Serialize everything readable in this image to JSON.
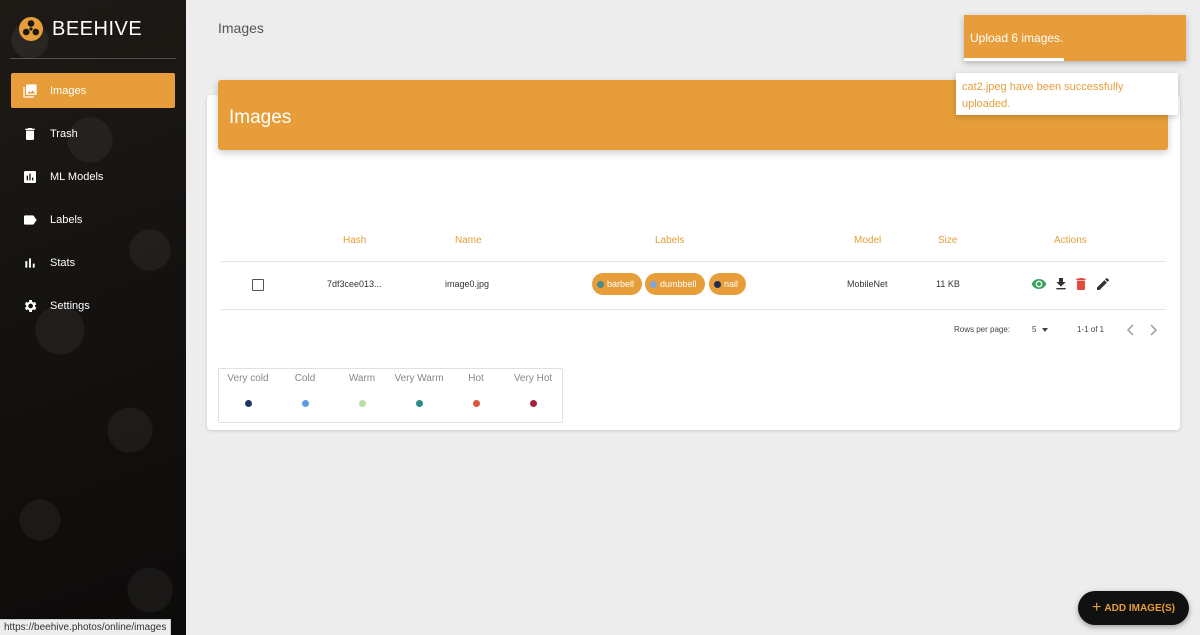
{
  "brand": {
    "name": "BEEHIVE",
    "icon": "beehive-logo-icon"
  },
  "sidebar": {
    "items": [
      {
        "label": "Images",
        "icon": "image-icon",
        "active": true
      },
      {
        "label": "Trash",
        "icon": "trash-icon"
      },
      {
        "label": "ML Models",
        "icon": "chart-icon"
      },
      {
        "label": "Labels",
        "icon": "label-icon"
      },
      {
        "label": "Stats",
        "icon": "bar-chart-icon"
      },
      {
        "label": "Settings",
        "icon": "gear-icon"
      }
    ]
  },
  "status_url": "https://beehive.photos/online/images",
  "page": {
    "title": "Images"
  },
  "card": {
    "title": "Images"
  },
  "table": {
    "headers": {
      "hash": "Hash",
      "name": "Name",
      "labels": "Labels",
      "model": "Model",
      "size": "Size",
      "actions": "Actions"
    },
    "rows": [
      {
        "hash": "7df3cee013...",
        "name": "image0.jpg",
        "labels": [
          {
            "text": "barbell",
            "color": "#4a8a8a"
          },
          {
            "text": "dumbbell",
            "color": "#7fa6d8"
          },
          {
            "text": "nail",
            "color": "#1f2d4f"
          }
        ],
        "model": "MobileNet",
        "size": "11 KB"
      }
    ]
  },
  "pagination": {
    "rows_label": "Rows per page:",
    "rows_value": "5",
    "range": "1-1 of 1"
  },
  "legend": [
    {
      "label": "Very cold",
      "color": "#1f3566"
    },
    {
      "label": "Cold",
      "color": "#5b9be6"
    },
    {
      "label": "Warm",
      "color": "#b8e0a6"
    },
    {
      "label": "Very Warm",
      "color": "#2e8b8b"
    },
    {
      "label": "Hot",
      "color": "#d9573b"
    },
    {
      "label": "Very Hot",
      "color": "#a3213a"
    }
  ],
  "toasts": {
    "upload": "Upload 6 images.",
    "success": "cat2.jpeg have been successfully uploaded."
  },
  "fab": {
    "label": "ADD IMAGE(S)"
  },
  "colors": {
    "accent": "#e79e3a",
    "view": "#3aa15a",
    "delete": "#e04b3a"
  }
}
